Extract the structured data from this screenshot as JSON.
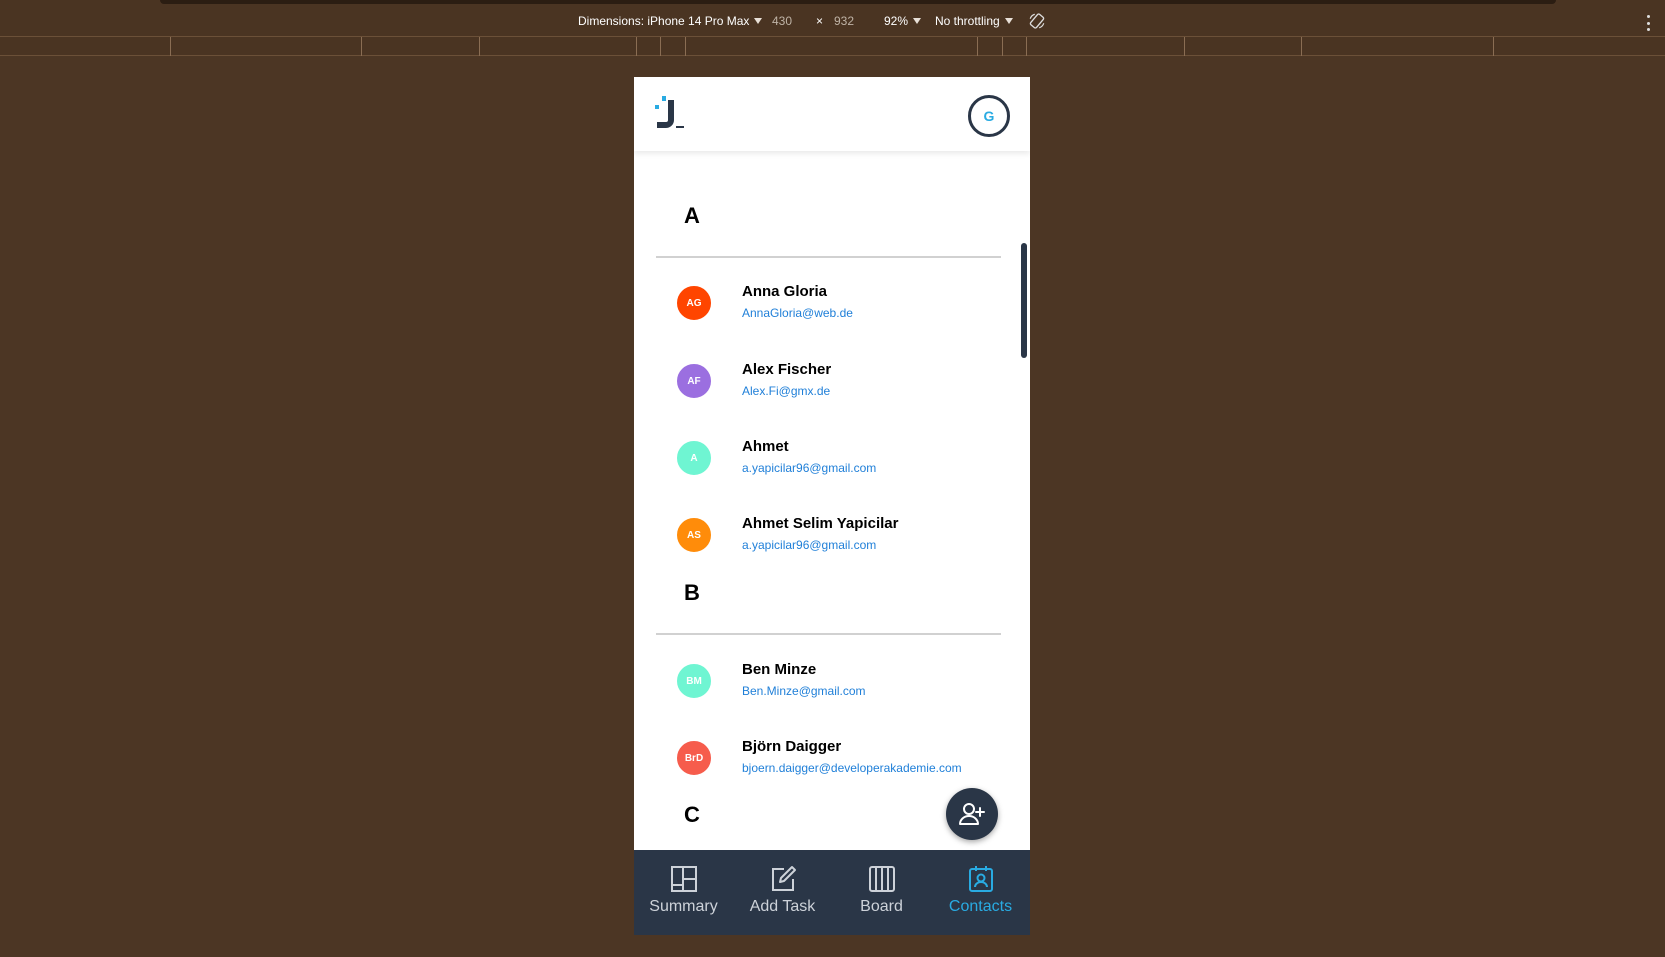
{
  "devtools": {
    "dimensions_label": "Dimensions: iPhone 14 Pro Max",
    "width": "430",
    "times": "×",
    "height": "932",
    "zoom": "92%",
    "throttling": "No throttling"
  },
  "header": {
    "user_initial": "G"
  },
  "sections": [
    {
      "letter": "A",
      "contacts": [
        {
          "initials": "AG",
          "name": "Anna Gloria",
          "email": "AnnaGloria@web.de",
          "color": "#ff4500"
        },
        {
          "initials": "AF",
          "name": "Alex Fischer",
          "email": "Alex.Fi@gmx.de",
          "color": "#9b6fe0"
        },
        {
          "initials": "A",
          "name": "Ahmet",
          "email": "a.yapicilar96@gmail.com",
          "color": "#6ff5d2"
        },
        {
          "initials": "AS",
          "name": "Ahmet Selim Yapicilar",
          "email": "a.yapicilar96@gmail.com",
          "color": "#ff8c0a"
        }
      ]
    },
    {
      "letter": "B",
      "contacts": [
        {
          "initials": "BM",
          "name": "Ben Minze",
          "email": "Ben.Minze@gmail.com",
          "color": "#6ff5d2"
        },
        {
          "initials": "BrD",
          "name": "Björn Daigger",
          "email": "bjoern.daigger@developerakademie.com",
          "color": "#f65c4c"
        }
      ]
    },
    {
      "letter": "C",
      "contacts": []
    }
  ],
  "nav": [
    {
      "label": "Summary",
      "icon": "summary-icon",
      "active": false
    },
    {
      "label": "Add Task",
      "icon": "add-task-icon",
      "active": false
    },
    {
      "label": "Board",
      "icon": "board-icon",
      "active": false
    },
    {
      "label": "Contacts",
      "icon": "contacts-icon",
      "active": true
    }
  ],
  "fab_icon": "add-person-icon",
  "colors": {
    "nav_bg": "#2a3647",
    "accent": "#29abe2",
    "email": "#1f7fd8"
  }
}
